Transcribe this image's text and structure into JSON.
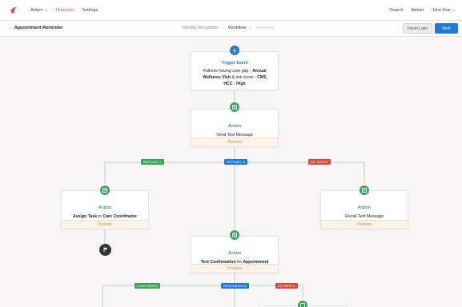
{
  "nav": {
    "items": [
      {
        "label": "Admin ⌄"
      },
      {
        "label": "Outreach"
      },
      {
        "label": "Settings"
      }
    ],
    "right": [
      {
        "label": "Search"
      },
      {
        "label": "Admin"
      },
      {
        "label": "John Doe ⌄"
      }
    ]
  },
  "subbar": {
    "back": "← Appointment Reminder",
    "steps": [
      "Identify Recipients",
      "›",
      "Workflow",
      "›",
      "Summary"
    ],
    "finish_later": "Finish Later",
    "next": "Next"
  },
  "trigger": {
    "title": "Trigger Event",
    "desc_pre": "Patients having care gap - ",
    "desc_b1": "Annual Wellness Visit",
    "desc_mid": " & risk score - ",
    "desc_b2": "CMS HCC - High"
  },
  "action1": {
    "title": "Action",
    "desc": "Send Text Message",
    "preview": "Preview"
  },
  "branches1": [
    "REPLIED Y",
    "REPLIED N",
    "NO REPLY"
  ],
  "action_left": {
    "title": "Action",
    "desc_pre": "Assign Task ",
    "desc_mid": "to",
    "desc_post": " Care Coordinator",
    "preview": "Preview"
  },
  "action_right": {
    "title": "Action",
    "desc": "Recall Text Message",
    "preview": "Preview"
  },
  "action_mid": {
    "title": "Action",
    "desc_pre": "Text Confirmation ",
    "desc_mid": "for",
    "desc_post": " Appointment",
    "preview": "Preview"
  },
  "branches2": [
    "CONFIRMED",
    "RESCHEDULE",
    "NO REPLY"
  ],
  "colors": {
    "accent": "#e0502f",
    "primary": "#1f7ae0",
    "success": "#3aa55a",
    "danger": "#d94b3a",
    "preview_bg": "#fdf3e6"
  }
}
